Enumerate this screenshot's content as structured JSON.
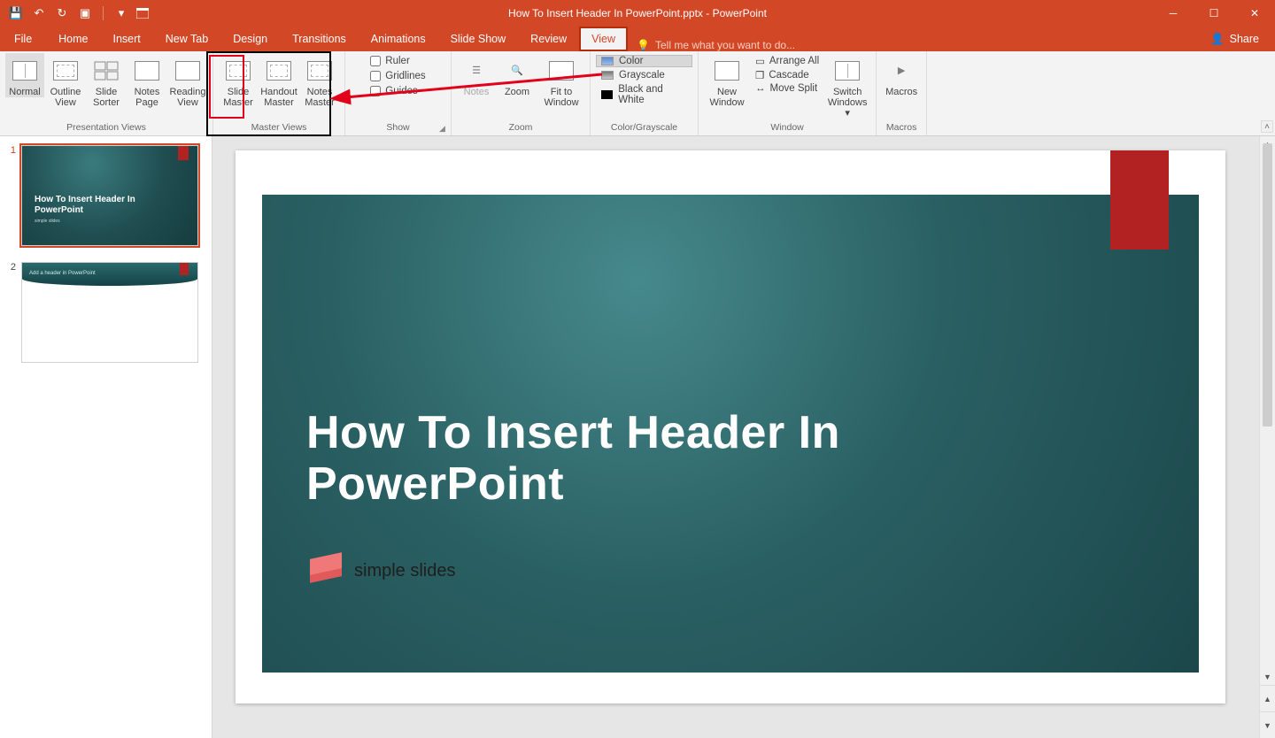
{
  "title": "How To Insert Header In PowerPoint.pptx - PowerPoint",
  "tabs": {
    "file": "File",
    "home": "Home",
    "insert": "Insert",
    "newtab": "New Tab",
    "design": "Design",
    "transitions": "Transitions",
    "animations": "Animations",
    "slideshow": "Slide Show",
    "review": "Review",
    "view": "View"
  },
  "tellme": {
    "placeholder": "Tell me what you want to do..."
  },
  "share": "Share",
  "ribbon": {
    "presentation_views": {
      "label": "Presentation Views",
      "normal": "Normal",
      "outline": "Outline View",
      "sorter": "Slide Sorter",
      "notes": "Notes Page",
      "reading": "Reading View"
    },
    "master_views": {
      "label": "Master Views",
      "slide": "Slide Master",
      "handout": "Handout Master",
      "notesm": "Notes Master"
    },
    "show": {
      "label": "Show",
      "ruler": "Ruler",
      "gridlines": "Gridlines",
      "guides": "Guides"
    },
    "zoom": {
      "label": "Zoom",
      "zoom": "Zoom",
      "fit": "Fit to Window",
      "notes": "Notes"
    },
    "color": {
      "label": "Color/Grayscale",
      "color": "Color",
      "grayscale": "Grayscale",
      "bw": "Black and White"
    },
    "window": {
      "label": "Window",
      "neww": "New Window",
      "arrange": "Arrange All",
      "cascade": "Cascade",
      "move": "Move Split",
      "switch": "Switch Windows"
    },
    "macros": {
      "label": "Macros",
      "macros": "Macros"
    }
  },
  "thumbs": {
    "n1": "1",
    "n2": "2",
    "t1": "How To Insert Header In PowerPoint",
    "t1sub": "simple slides",
    "t2": "Add a header in PowerPoint"
  },
  "slide": {
    "title": "How To Insert Header In PowerPoint",
    "logo_text": "simple slides"
  }
}
